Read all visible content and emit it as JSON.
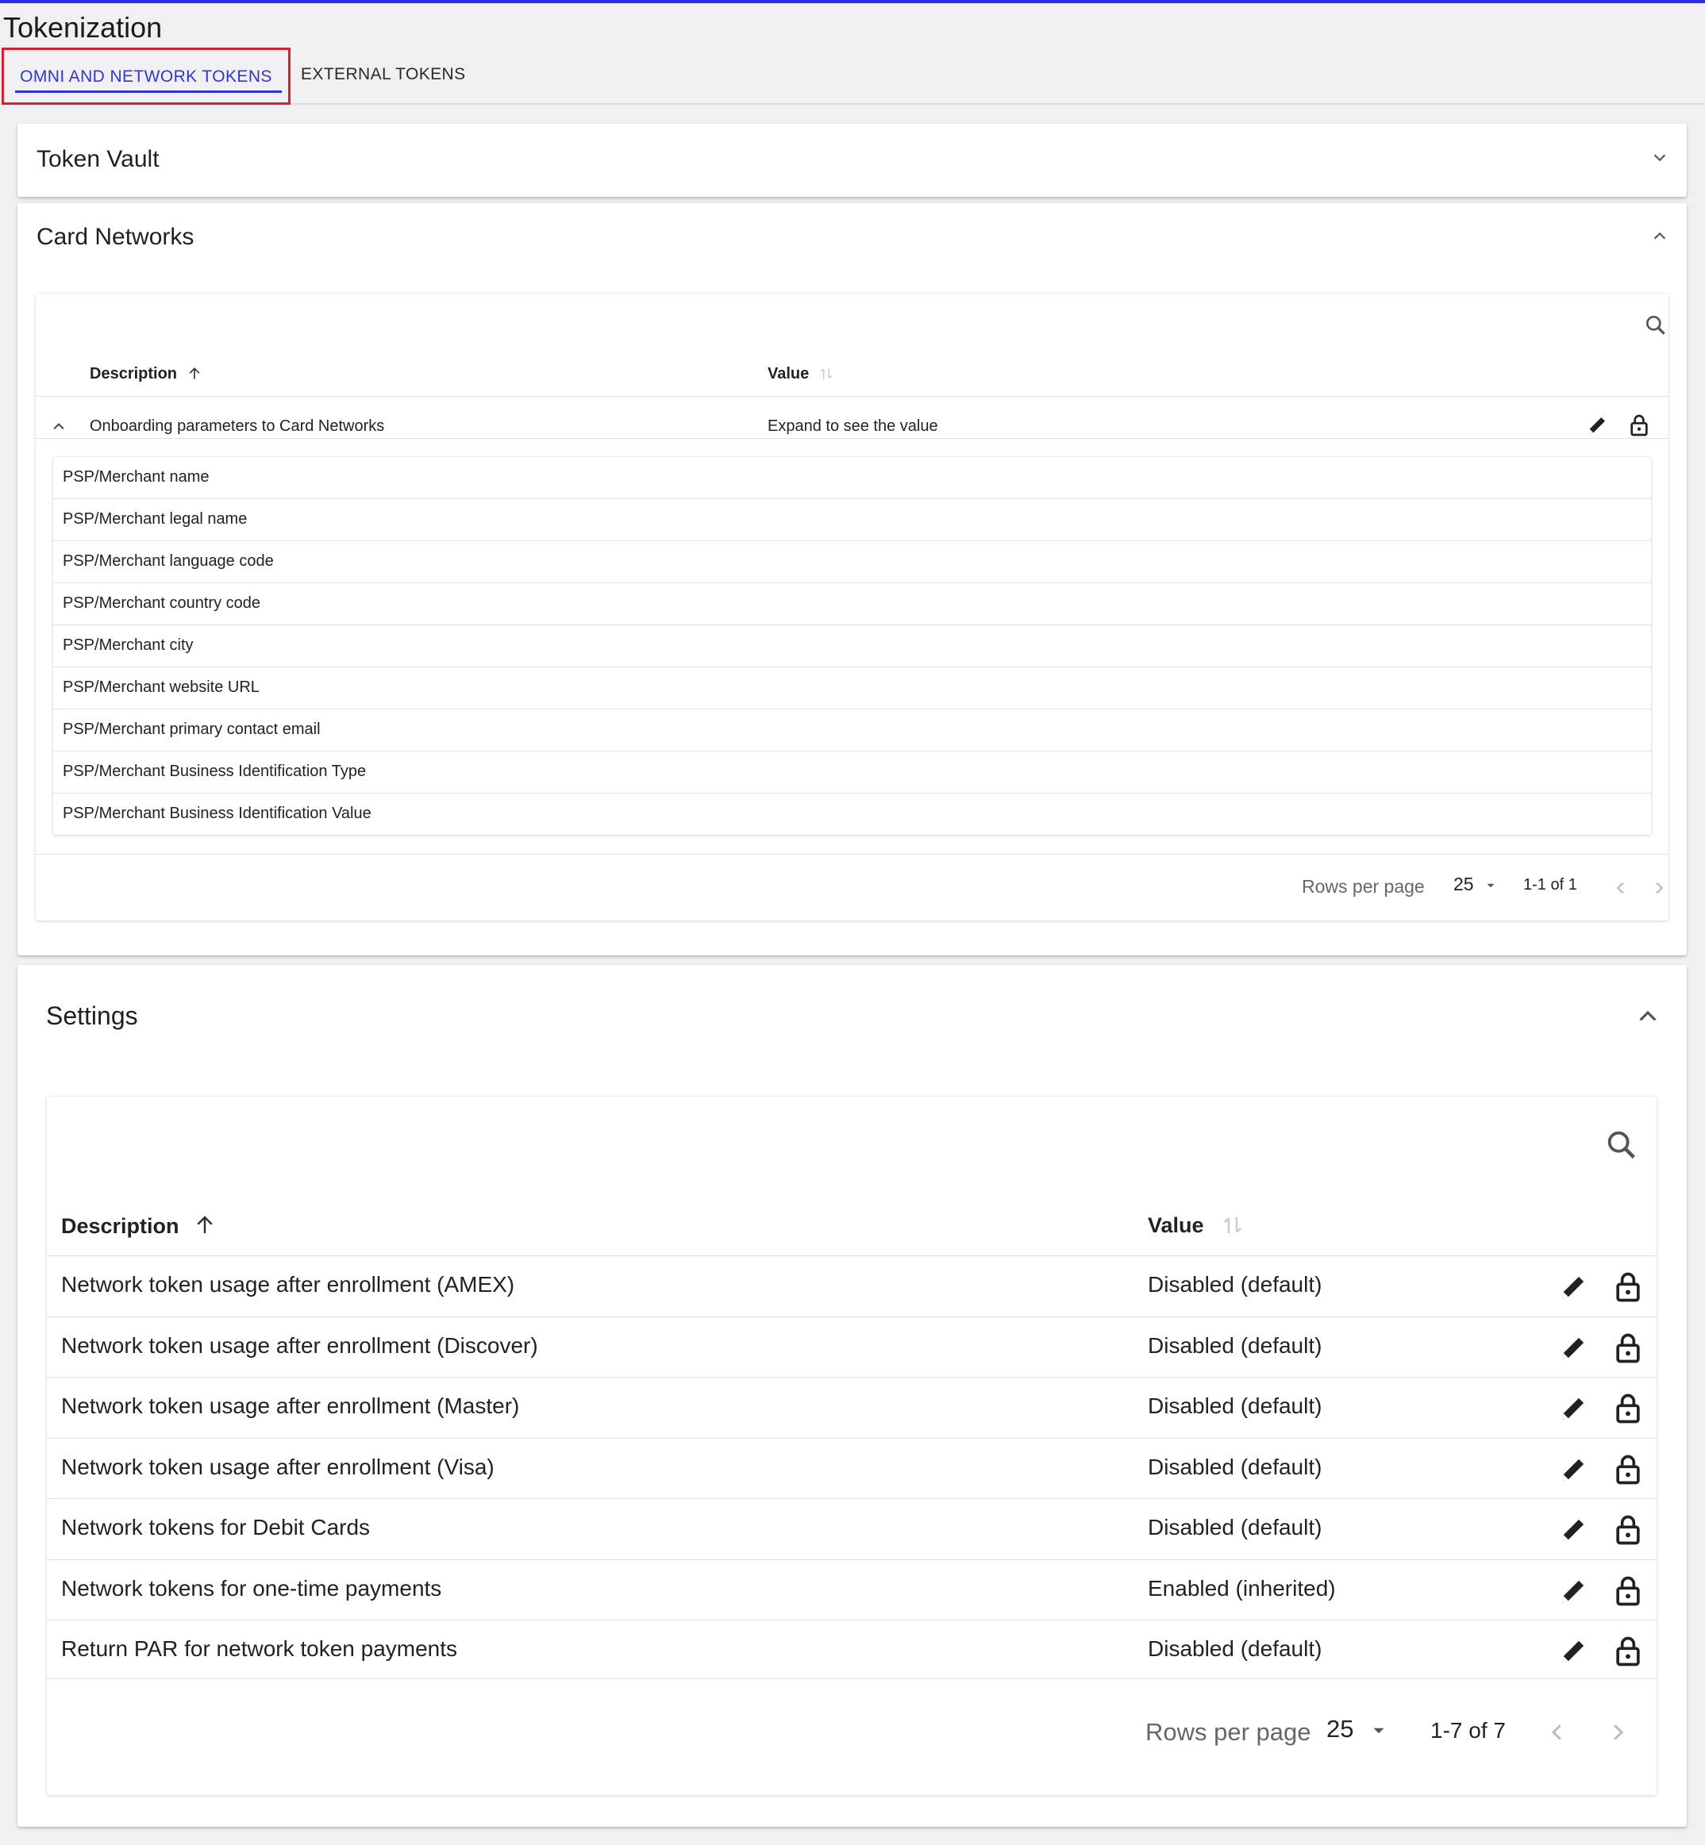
{
  "page": {
    "title": "Tokenization"
  },
  "tabs": {
    "omni": "OMNI AND NETWORK TOKENS",
    "external": "EXTERNAL TOKENS"
  },
  "colors": {
    "accent": "#3535c8",
    "highlight_border": "#d9202b"
  },
  "token_vault": {
    "title": "Token Vault"
  },
  "card_networks": {
    "title": "Card Networks",
    "col_description": "Description",
    "col_value": "Value",
    "row": {
      "description": "Onboarding parameters to Card Networks",
      "value": "Expand to see the value"
    },
    "sub_items": [
      "PSP/Merchant name",
      "PSP/Merchant legal name",
      "PSP/Merchant language code",
      "PSP/Merchant country code",
      "PSP/Merchant city",
      "PSP/Merchant website URL",
      "PSP/Merchant primary contact email",
      "PSP/Merchant Business Identification Type",
      "PSP/Merchant Business Identification Value"
    ],
    "pagination": {
      "rows_label": "Rows per page",
      "rows_value": "25",
      "range": "1-1 of 1"
    }
  },
  "settings": {
    "title": "Settings",
    "col_description": "Description",
    "col_value": "Value",
    "rows": [
      {
        "description": "Network token usage after enrollment (AMEX)",
        "value": "Disabled (default)"
      },
      {
        "description": "Network token usage after enrollment (Discover)",
        "value": "Disabled (default)"
      },
      {
        "description": "Network token usage after enrollment (Master)",
        "value": "Disabled (default)"
      },
      {
        "description": "Network token usage after enrollment (Visa)",
        "value": "Disabled (default)"
      },
      {
        "description": "Network tokens for Debit Cards",
        "value": "Disabled (default)"
      },
      {
        "description": "Network tokens for one-time payments",
        "value": "Enabled (inherited)"
      },
      {
        "description": "Return PAR for network token payments",
        "value": "Disabled (default)"
      }
    ],
    "pagination": {
      "rows_label": "Rows per page",
      "rows_value": "25",
      "range": "1-7 of 7"
    }
  }
}
